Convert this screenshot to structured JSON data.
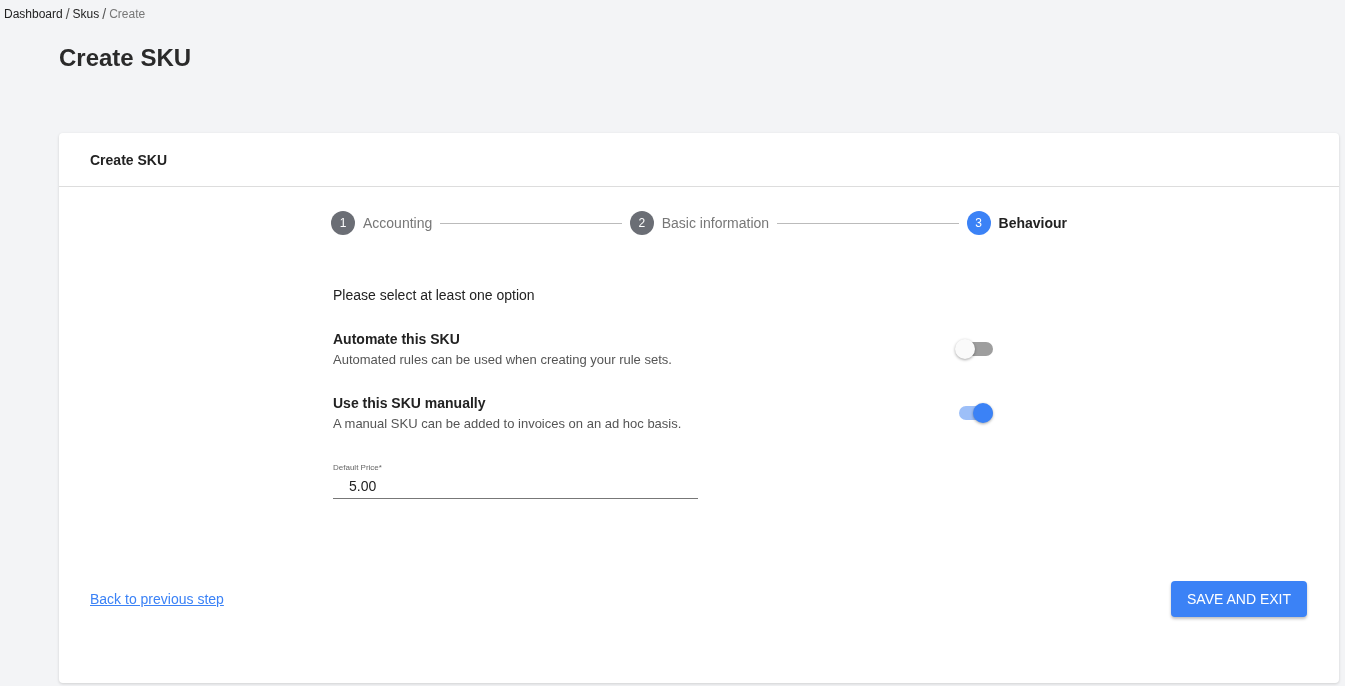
{
  "breadcrumb": [
    {
      "label": "Dashboard",
      "current": false,
      "separator": "/"
    },
    {
      "label": "Skus",
      "current": false,
      "separator": "/"
    },
    {
      "label": "Create",
      "current": true
    }
  ],
  "page_title": "Create SKU",
  "card": {
    "title": "Create SKU",
    "steps": [
      {
        "number": "1",
        "label": "Accounting",
        "selected": false
      },
      {
        "number": "2",
        "label": "Basic information",
        "selected": false
      },
      {
        "number": "3",
        "label": "Behaviour",
        "selected": true
      }
    ],
    "prompt": "Please select at least one option",
    "options": [
      {
        "title": "Automate this SKU",
        "description": "Automated rules can be used when creating your rule sets.",
        "on": false
      },
      {
        "title": "Use this SKU manually",
        "description": "A manual SKU can be added to invoices on an ad hoc basis.",
        "on": true
      }
    ],
    "price_field": {
      "label": "Default Price*",
      "value": "5.00"
    },
    "back_link": "Back to previous step",
    "save_button": "SAVE AND EXIT"
  }
}
